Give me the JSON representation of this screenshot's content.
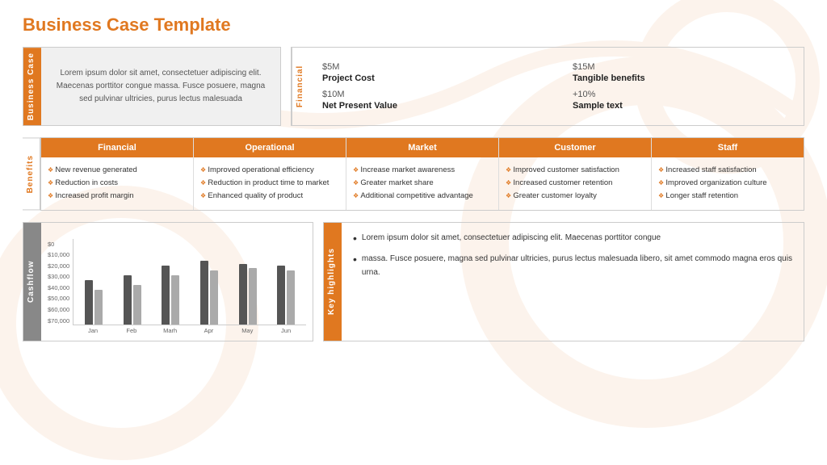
{
  "title": "Business Case Template",
  "business_case": {
    "label": "Business Case",
    "content": "Lorem ipsum dolor sit amet, consectetuer adipiscing elit. Maecenas porttitor congue massa. Fusce posuere, magna sed pulvinar ultricies, purus lectus malesuada"
  },
  "financial": {
    "label": "Financial",
    "items": [
      {
        "value": "$5M",
        "label": "Project Cost"
      },
      {
        "value": "$15M",
        "label": "Tangible benefits"
      },
      {
        "value": "$10M",
        "label": "Net Present Value"
      },
      {
        "value": "+10%",
        "label": "Sample text"
      }
    ]
  },
  "benefits": {
    "label": "Benefits",
    "columns": [
      {
        "header": "Financial",
        "items": [
          "New revenue generated",
          "Reduction in costs",
          "Increased profit margin"
        ]
      },
      {
        "header": "Operational",
        "items": [
          "Improved operational efficiency",
          "Reduction in product time to market",
          "Enhanced quality of product"
        ]
      },
      {
        "header": "Market",
        "items": [
          "Increase market awareness",
          "Greater market share",
          "Additional competitive advantage"
        ]
      },
      {
        "header": "Customer",
        "items": [
          "Improved customer satisfaction",
          "Increased customer retention",
          "Greater customer loyalty"
        ]
      },
      {
        "header": "Staff",
        "items": [
          "Increased staff satisfaction",
          "Improved organization culture",
          "Longer staff retention"
        ]
      }
    ]
  },
  "cashflow": {
    "label": "Cashflow",
    "y_labels": [
      "$70,000",
      "$60,000",
      "$50,000",
      "$40,000",
      "$30,000",
      "$20,000",
      "$10,000",
      "$0"
    ],
    "x_labels": [
      "Jan",
      "Feb",
      "Marh",
      "Apr",
      "May",
      "Jun"
    ],
    "bars": [
      {
        "dark": 45,
        "light": 35
      },
      {
        "dark": 50,
        "light": 40
      },
      {
        "dark": 60,
        "light": 50
      },
      {
        "dark": 65,
        "light": 55
      },
      {
        "dark": 62,
        "light": 58
      },
      {
        "dark": 60,
        "light": 55
      }
    ]
  },
  "highlights": {
    "label": "Key highlights",
    "items": [
      "Lorem ipsum dolor sit amet, consectetuer adipiscing elit. Maecenas porttitor congue",
      "massa. Fusce posuere, magna sed pulvinar ultricies, purus lectus malesuada libero, sit amet commodo magna eros quis urna."
    ]
  }
}
